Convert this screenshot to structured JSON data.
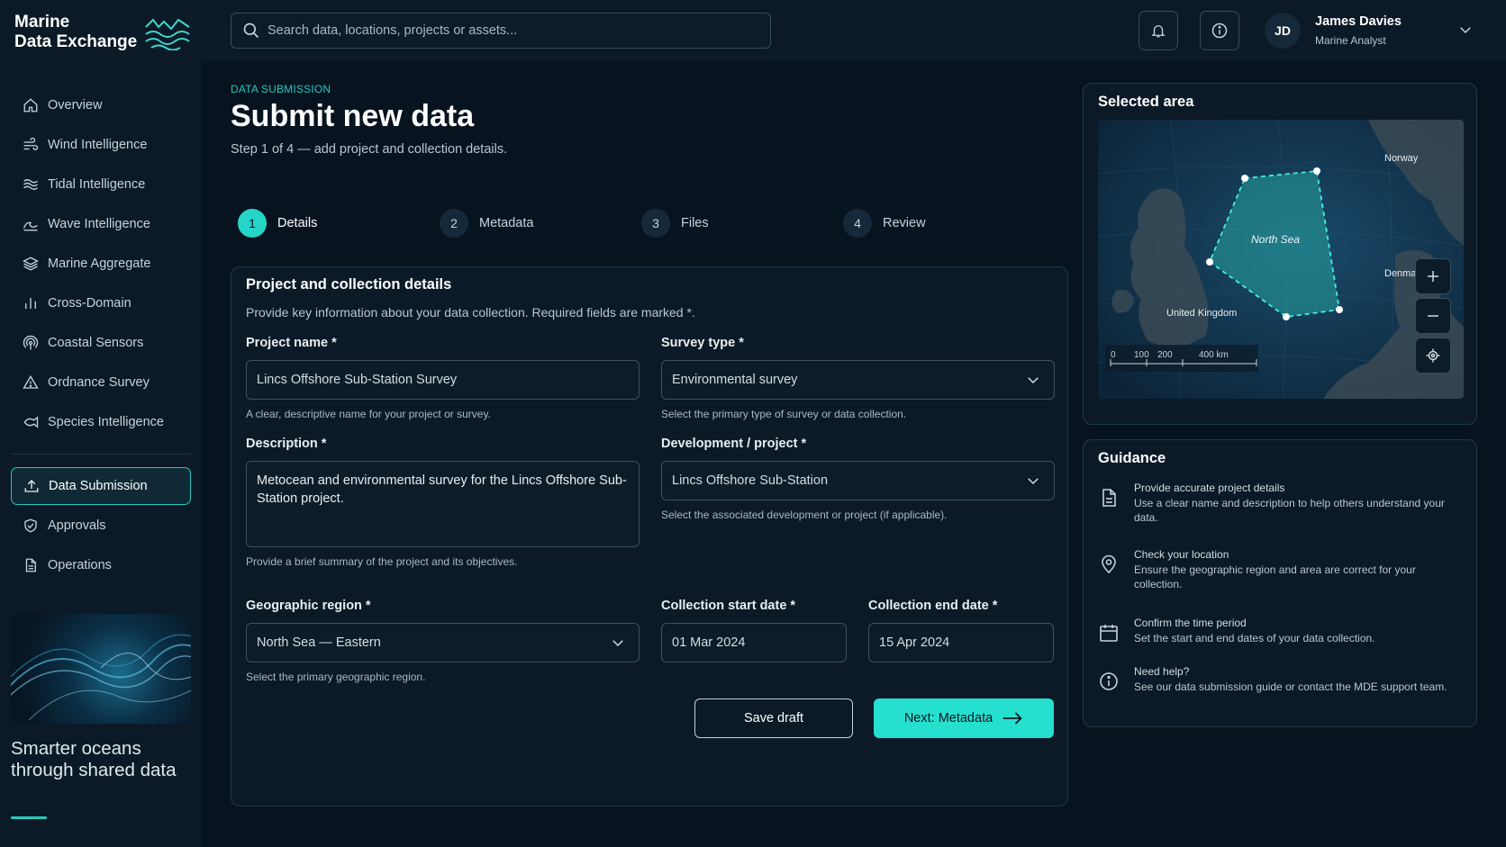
{
  "brand": {
    "line1": "Marine",
    "line2": "Data Exchange"
  },
  "search": {
    "placeholder": "Search data, locations, projects or assets..."
  },
  "user": {
    "initials": "JD",
    "name": "James Davies",
    "role": "Marine Analyst"
  },
  "sidebar": {
    "items": [
      {
        "label": "Overview",
        "icon": "home-icon"
      },
      {
        "label": "Wind Intelligence",
        "icon": "wind-icon"
      },
      {
        "label": "Tidal Intelligence",
        "icon": "tide-icon"
      },
      {
        "label": "Wave Intelligence",
        "icon": "wave-icon"
      },
      {
        "label": "Marine Aggregate",
        "icon": "layers-icon"
      },
      {
        "label": "Cross-Domain",
        "icon": "bars-icon"
      },
      {
        "label": "Coastal Sensors",
        "icon": "sensor-icon"
      },
      {
        "label": "Ordnance Survey",
        "icon": "warning-icon"
      },
      {
        "label": "Species Intelligence",
        "icon": "fish-icon"
      }
    ],
    "secondary": [
      {
        "label": "Data Submission",
        "icon": "upload-icon",
        "active": true
      },
      {
        "label": "Approvals",
        "icon": "shield-check-icon"
      },
      {
        "label": "Operations",
        "icon": "document-icon"
      }
    ],
    "tagline": "Smarter oceans through shared data"
  },
  "page": {
    "eyebrow": "DATA SUBMISSION",
    "title": "Submit new data",
    "subtitle": "Step 1 of 4 — add project and collection details."
  },
  "steps": [
    {
      "num": "1",
      "label": "Details",
      "active": true
    },
    {
      "num": "2",
      "label": "Metadata"
    },
    {
      "num": "3",
      "label": "Files"
    },
    {
      "num": "4",
      "label": "Review"
    }
  ],
  "form": {
    "title": "Project and collection details",
    "description": "Provide key information about your data collection. Required fields are marked *.",
    "project_name": {
      "label": "Project name *",
      "value": "Lincs Offshore Sub-Station Survey",
      "hint": "A clear, descriptive name for your project or survey."
    },
    "survey_type": {
      "label": "Survey type *",
      "value": "Environmental survey",
      "hint": "Select the primary type of survey or data collection."
    },
    "description_field": {
      "label": "Description *",
      "value": "Metocean and environmental survey for the Lincs Offshore Sub-Station project.",
      "hint": "Provide a brief summary of the project and its objectives."
    },
    "development": {
      "label": "Development / project *",
      "value": "Lincs Offshore Sub-Station",
      "hint": "Select the associated development or project (if applicable)."
    },
    "region": {
      "label": "Geographic region *",
      "value": "North Sea — Eastern",
      "hint": "Select the primary geographic region."
    },
    "start_date": {
      "label": "Collection start date *",
      "value": "01 Mar 2024"
    },
    "end_date": {
      "label": "Collection end date *",
      "value": "15 Apr 2024"
    },
    "save_label": "Save draft",
    "next_label": "Next: Metadata"
  },
  "map": {
    "title": "Selected area",
    "labels": {
      "norway": "Norway",
      "denmark": "Denma",
      "uk": "United Kingdom",
      "area": "North Sea"
    },
    "scale": [
      "0",
      "100",
      "200",
      "400 km"
    ]
  },
  "guidance": {
    "title": "Guidance",
    "items": [
      {
        "icon": "document-icon",
        "head": "Provide accurate project details",
        "text": "Use a clear name and description to help others understand your data."
      },
      {
        "icon": "location-pin-icon",
        "head": "Check your location",
        "text": "Ensure the geographic region and area are correct for your collection."
      },
      {
        "icon": "calendar-icon",
        "head": "Confirm the time period",
        "text": "Set the start and end dates of your data collection."
      },
      {
        "icon": "info-icon",
        "head": "Need help?",
        "text": "See our data submission guide or contact the MDE support team."
      }
    ]
  },
  "colors": {
    "accent": "#25e0cf",
    "background": "#07141f",
    "panel": "#0b1a26"
  }
}
